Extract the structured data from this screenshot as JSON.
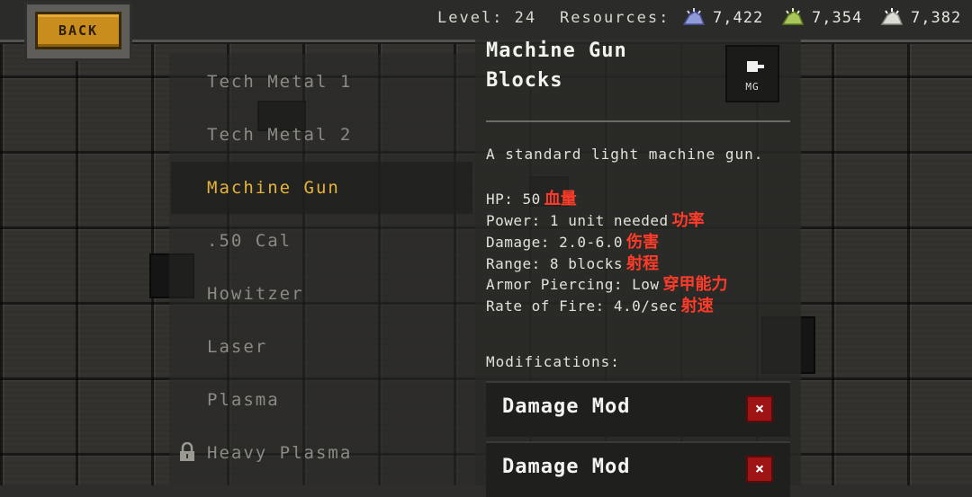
{
  "topbar": {
    "back_label": "BACK",
    "level_text": "Level: 24",
    "resources_label": "Resources:",
    "resources": [
      {
        "icon": "blue-ore-icon",
        "color": "#8f9ad6",
        "value": "7,422"
      },
      {
        "icon": "green-ore-icon",
        "color": "#a9c65a",
        "value": "7,354"
      },
      {
        "icon": "white-ore-icon",
        "color": "#dcdcd4",
        "value": "7,382"
      }
    ]
  },
  "block_list": {
    "items": [
      {
        "label": "Tech Metal 1",
        "active": false
      },
      {
        "label": "Tech Metal 2",
        "active": false
      },
      {
        "label": "Machine Gun",
        "active": true
      },
      {
        "label": ".50 Cal",
        "active": false
      },
      {
        "label": "Howitzer",
        "active": false
      },
      {
        "label": "Laser",
        "active": false
      },
      {
        "label": "Plasma",
        "active": false
      },
      {
        "label": "Heavy Plasma",
        "active": false,
        "locked": true
      }
    ]
  },
  "detail": {
    "title_line1": "Machine Gun",
    "title_line2": "Blocks",
    "icon_label": "MG",
    "description": "A standard light machine gun.",
    "stats": [
      {
        "text": "HP: 50",
        "annotation": "血量"
      },
      {
        "text": "Power: 1 unit needed",
        "annotation": "功率"
      },
      {
        "text": "Damage: 2.0-6.0",
        "annotation": "伤害"
      },
      {
        "text": "Range: 8 blocks",
        "annotation": "射程"
      },
      {
        "text": "Armor Piercing: Low",
        "annotation": "穿甲能力"
      },
      {
        "text": "Rate of Fire: 4.0/sec",
        "annotation": "射速"
      }
    ],
    "modifications_label": "Modifications:",
    "mods": [
      {
        "label": "Damage Mod",
        "remove": "×"
      },
      {
        "label": "Damage Mod",
        "remove": "×"
      }
    ]
  },
  "colors": {
    "accent": "#e6b337",
    "back_button": "#c98d1e",
    "annotation": "#ff3b2a",
    "remove_button": "#9e1414"
  }
}
